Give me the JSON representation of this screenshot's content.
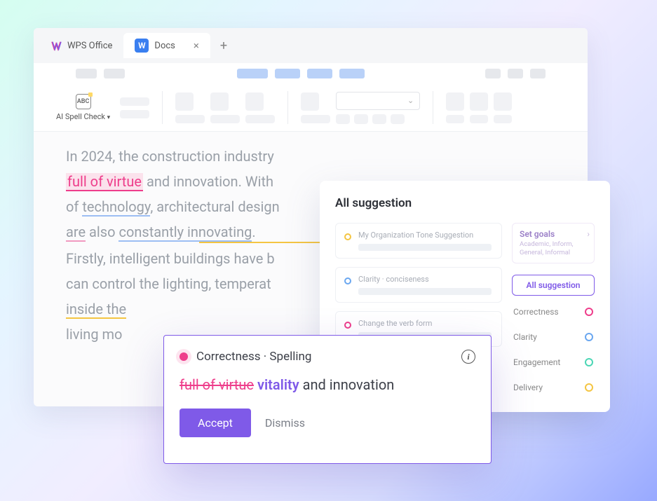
{
  "tabs": {
    "wps_label": "WPS Office",
    "docs_label": "Docs",
    "word_glyph": "W"
  },
  "toolbar": {
    "spellcheck_label": "AI Spell Check",
    "spellcheck_glyph": "ABC"
  },
  "document": {
    "line1a": "In 2024, the construction industry",
    "hl_phrase": "full of virtue",
    "line2b": " and innovation. With",
    "line3a": "of ",
    "tech": "technology",
    "line3b": ", architectural design",
    "are": "are",
    "line4a": " also ",
    "innov": "constantly innovating",
    "period": ".",
    "line5": "Firstly, intelligent buildings have b",
    "line6": "can control the lighting, temperat",
    "inside": "inside the",
    "line8": "living mo"
  },
  "panel": {
    "title": "All suggestion",
    "cards": [
      {
        "label": "My  Organization Tone Suggestion",
        "dot": "yellow"
      },
      {
        "label": "Clarity · conciseness",
        "dot": "blue"
      },
      {
        "label": "Change the verb form",
        "dot": "pink"
      }
    ],
    "goals": {
      "title": "Set goals",
      "subtitle": "Academic, Inform, General, Informal"
    },
    "filter_all": "All suggestion",
    "categories": [
      {
        "name": "Correctness",
        "ring": "ring-pink"
      },
      {
        "name": "Clarity",
        "ring": "ring-blue"
      },
      {
        "name": "Engagement",
        "ring": "ring-teal"
      },
      {
        "name": "Delivery",
        "ring": "ring-yellow"
      }
    ]
  },
  "correction": {
    "type_label": "Correctness · Spelling",
    "strike": "full of virtue",
    "insert": "vitality",
    "rest": " and innovation",
    "accept": "Accept",
    "dismiss": "Dismiss"
  }
}
